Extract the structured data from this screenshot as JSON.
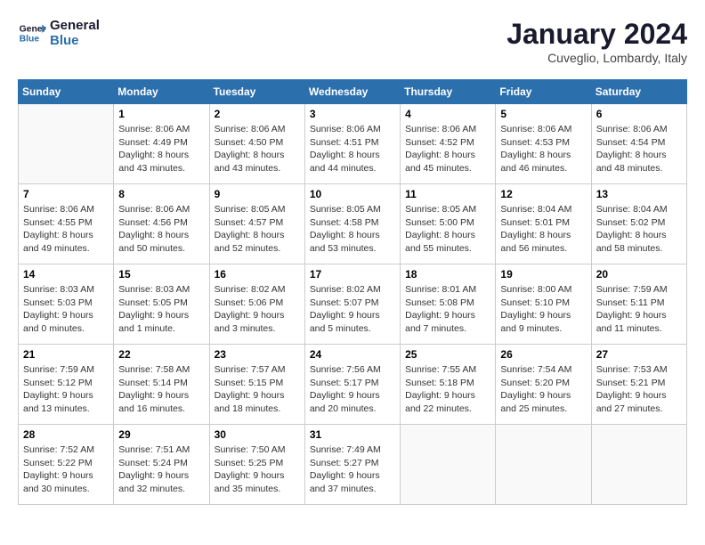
{
  "logo": {
    "line1": "General",
    "line2": "Blue"
  },
  "title": "January 2024",
  "subtitle": "Cuveglio, Lombardy, Italy",
  "weekdays": [
    "Sunday",
    "Monday",
    "Tuesday",
    "Wednesday",
    "Thursday",
    "Friday",
    "Saturday"
  ],
  "weeks": [
    [
      {
        "day": "",
        "info": ""
      },
      {
        "day": "1",
        "info": "Sunrise: 8:06 AM\nSunset: 4:49 PM\nDaylight: 8 hours\nand 43 minutes."
      },
      {
        "day": "2",
        "info": "Sunrise: 8:06 AM\nSunset: 4:50 PM\nDaylight: 8 hours\nand 43 minutes."
      },
      {
        "day": "3",
        "info": "Sunrise: 8:06 AM\nSunset: 4:51 PM\nDaylight: 8 hours\nand 44 minutes."
      },
      {
        "day": "4",
        "info": "Sunrise: 8:06 AM\nSunset: 4:52 PM\nDaylight: 8 hours\nand 45 minutes."
      },
      {
        "day": "5",
        "info": "Sunrise: 8:06 AM\nSunset: 4:53 PM\nDaylight: 8 hours\nand 46 minutes."
      },
      {
        "day": "6",
        "info": "Sunrise: 8:06 AM\nSunset: 4:54 PM\nDaylight: 8 hours\nand 48 minutes."
      }
    ],
    [
      {
        "day": "7",
        "info": "Sunrise: 8:06 AM\nSunset: 4:55 PM\nDaylight: 8 hours\nand 49 minutes."
      },
      {
        "day": "8",
        "info": "Sunrise: 8:06 AM\nSunset: 4:56 PM\nDaylight: 8 hours\nand 50 minutes."
      },
      {
        "day": "9",
        "info": "Sunrise: 8:05 AM\nSunset: 4:57 PM\nDaylight: 8 hours\nand 52 minutes."
      },
      {
        "day": "10",
        "info": "Sunrise: 8:05 AM\nSunset: 4:58 PM\nDaylight: 8 hours\nand 53 minutes."
      },
      {
        "day": "11",
        "info": "Sunrise: 8:05 AM\nSunset: 5:00 PM\nDaylight: 8 hours\nand 55 minutes."
      },
      {
        "day": "12",
        "info": "Sunrise: 8:04 AM\nSunset: 5:01 PM\nDaylight: 8 hours\nand 56 minutes."
      },
      {
        "day": "13",
        "info": "Sunrise: 8:04 AM\nSunset: 5:02 PM\nDaylight: 8 hours\nand 58 minutes."
      }
    ],
    [
      {
        "day": "14",
        "info": "Sunrise: 8:03 AM\nSunset: 5:03 PM\nDaylight: 9 hours\nand 0 minutes."
      },
      {
        "day": "15",
        "info": "Sunrise: 8:03 AM\nSunset: 5:05 PM\nDaylight: 9 hours\nand 1 minute."
      },
      {
        "day": "16",
        "info": "Sunrise: 8:02 AM\nSunset: 5:06 PM\nDaylight: 9 hours\nand 3 minutes."
      },
      {
        "day": "17",
        "info": "Sunrise: 8:02 AM\nSunset: 5:07 PM\nDaylight: 9 hours\nand 5 minutes."
      },
      {
        "day": "18",
        "info": "Sunrise: 8:01 AM\nSunset: 5:08 PM\nDaylight: 9 hours\nand 7 minutes."
      },
      {
        "day": "19",
        "info": "Sunrise: 8:00 AM\nSunset: 5:10 PM\nDaylight: 9 hours\nand 9 minutes."
      },
      {
        "day": "20",
        "info": "Sunrise: 7:59 AM\nSunset: 5:11 PM\nDaylight: 9 hours\nand 11 minutes."
      }
    ],
    [
      {
        "day": "21",
        "info": "Sunrise: 7:59 AM\nSunset: 5:12 PM\nDaylight: 9 hours\nand 13 minutes."
      },
      {
        "day": "22",
        "info": "Sunrise: 7:58 AM\nSunset: 5:14 PM\nDaylight: 9 hours\nand 16 minutes."
      },
      {
        "day": "23",
        "info": "Sunrise: 7:57 AM\nSunset: 5:15 PM\nDaylight: 9 hours\nand 18 minutes."
      },
      {
        "day": "24",
        "info": "Sunrise: 7:56 AM\nSunset: 5:17 PM\nDaylight: 9 hours\nand 20 minutes."
      },
      {
        "day": "25",
        "info": "Sunrise: 7:55 AM\nSunset: 5:18 PM\nDaylight: 9 hours\nand 22 minutes."
      },
      {
        "day": "26",
        "info": "Sunrise: 7:54 AM\nSunset: 5:20 PM\nDaylight: 9 hours\nand 25 minutes."
      },
      {
        "day": "27",
        "info": "Sunrise: 7:53 AM\nSunset: 5:21 PM\nDaylight: 9 hours\nand 27 minutes."
      }
    ],
    [
      {
        "day": "28",
        "info": "Sunrise: 7:52 AM\nSunset: 5:22 PM\nDaylight: 9 hours\nand 30 minutes."
      },
      {
        "day": "29",
        "info": "Sunrise: 7:51 AM\nSunset: 5:24 PM\nDaylight: 9 hours\nand 32 minutes."
      },
      {
        "day": "30",
        "info": "Sunrise: 7:50 AM\nSunset: 5:25 PM\nDaylight: 9 hours\nand 35 minutes."
      },
      {
        "day": "31",
        "info": "Sunrise: 7:49 AM\nSunset: 5:27 PM\nDaylight: 9 hours\nand 37 minutes."
      },
      {
        "day": "",
        "info": ""
      },
      {
        "day": "",
        "info": ""
      },
      {
        "day": "",
        "info": ""
      }
    ]
  ]
}
